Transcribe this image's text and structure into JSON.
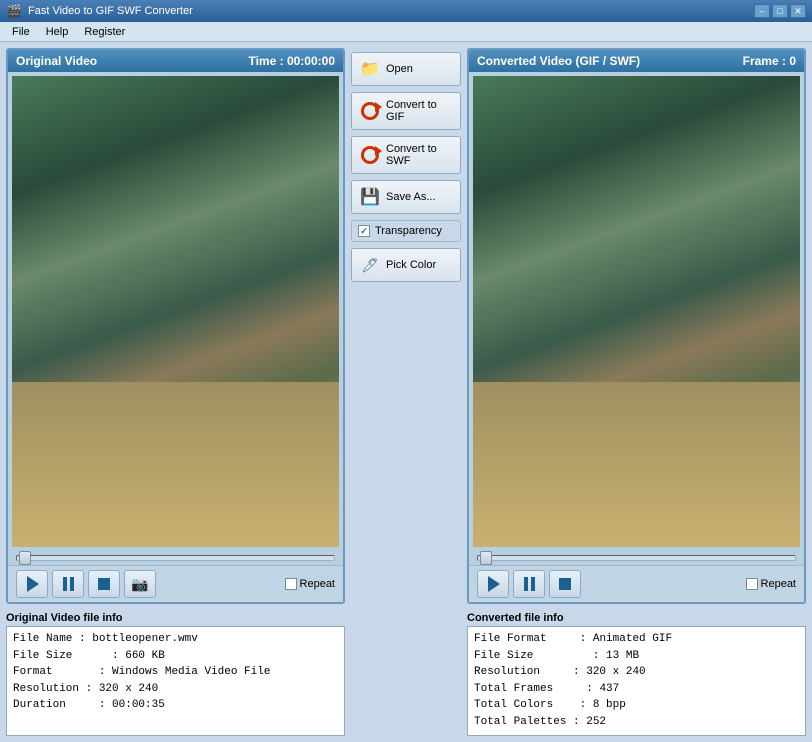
{
  "app": {
    "title": "Fast Video to GIF SWF Converter",
    "icon": "🎬"
  },
  "titlebar": {
    "minimize": "–",
    "maximize": "□",
    "close": "✕"
  },
  "menu": {
    "items": [
      "File",
      "Help",
      "Register"
    ]
  },
  "left_panel": {
    "title": "Original Video",
    "time_label": "Time :",
    "time_value": "00:00:00",
    "repeat_label": "Repeat"
  },
  "right_panel": {
    "title": "Converted Video (GIF / SWF)",
    "frame_label": "Frame :",
    "frame_value": "0",
    "repeat_label": "Repeat"
  },
  "buttons": {
    "open": "Open",
    "convert_gif": "Convert to GIF",
    "convert_swf": "Convert to SWF",
    "save_as": "Save As...",
    "transparency": "Transparency",
    "pick_color": "Pick Color"
  },
  "left_info": {
    "title": "Original Video file info",
    "file_name_label": "File Name",
    "file_name_value": "bottleopener.wmv",
    "file_size_label": "File Size",
    "file_size_value": "660 KB",
    "format_label": "Format",
    "format_value": "Windows Media Video File",
    "resolution_label": "Resolution",
    "resolution_value": "320 x 240",
    "duration_label": "Duration",
    "duration_value": "00:00:35"
  },
  "right_info": {
    "title": "Converted file info",
    "format_label": "File Format",
    "format_value": "Animated GIF",
    "size_label": "File Size",
    "size_value": "13 MB",
    "resolution_label": "Resolution",
    "resolution_value": "320 x 240",
    "frames_label": "Total Frames",
    "frames_value": "437",
    "colors_label": "Total Colors",
    "colors_value": "8 bpp",
    "palettes_label": "Total Palettes",
    "palettes_value": "252"
  }
}
